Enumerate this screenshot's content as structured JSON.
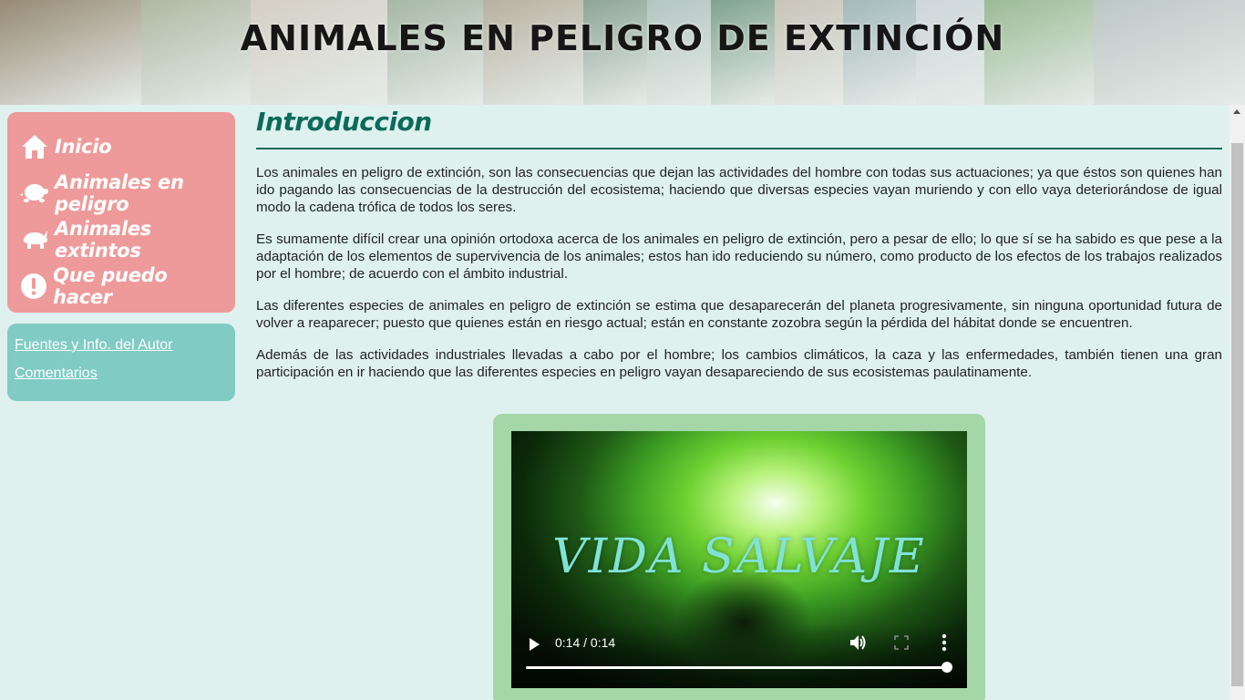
{
  "banner": {
    "title": "ANIMALES EN PELIGRO DE EXTINCIÓN",
    "tile_colors": [
      "#7a6a4d",
      "#9aa58a",
      "#c8c2b4",
      "#8ea48c",
      "#a39c86",
      "#6f8c7a",
      "#9fb5b0",
      "#5d8a6f",
      "#b9b4a6",
      "#8aa6a8",
      "#c0ccd0",
      "#7fa878",
      "#aab8b6"
    ]
  },
  "nav": {
    "items": [
      {
        "label": "Inicio",
        "icon": "home-icon"
      },
      {
        "label": "Animales en peligro",
        "icon": "turtle-icon"
      },
      {
        "label": "Animales extintos",
        "icon": "rhino-icon"
      },
      {
        "label": "Que puedo hacer",
        "icon": "exclamation-icon"
      }
    ]
  },
  "links": {
    "fuentes": "Fuentes y Info. del Autor",
    "comentarios": "Comentarios"
  },
  "main": {
    "title": "Introduccion",
    "paragraphs": [
      "Los animales en peligro de extinción, son las consecuencias que dejan las actividades del hombre con todas sus actuaciones; ya que éstos son quienes han ido pagando las consecuencias de la destrucción del ecosistema; haciendo que diversas especies vayan muriendo y con ello vaya deteriorándose de igual modo la cadena trófica de todos los seres.",
      "Es sumamente difícil crear una opinión ortodoxa acerca de los animales en peligro de extinción, pero a pesar de ello; lo que sí se ha sabido es que pese a la adaptación de los elementos de supervivencia de los animales; estos han ido reduciendo su número, como producto de los efectos de los trabajos realizados por el hombre; de acuerdo con el ámbito industrial.",
      "Las diferentes especies de animales en peligro de extinción se estima que desaparecerán del planeta progresivamente, sin ninguna oportunidad futura de volver a reaparecer; puesto que quienes están en riesgo actual; están en constante zozobra según la pérdida del hábitat donde se encuentren.",
      "Además de las actividades industriales llevadas a cabo por el hombre; los cambios climáticos, la caza y las enfermedades, también tienen una gran participación en ir haciendo que las diferentes especies en peligro vayan desapareciendo de sus ecosistemas paulatinamente."
    ]
  },
  "video": {
    "caption": "VIDA SALVAJE",
    "time": "0:14 / 0:14",
    "progress": 1.0
  },
  "colors": {
    "background": "#dff1ef",
    "nav_box": "#ee9a9a",
    "links_box": "#80cbc4",
    "title": "#0b6b5a",
    "video_frame": "#a5d6a7"
  }
}
